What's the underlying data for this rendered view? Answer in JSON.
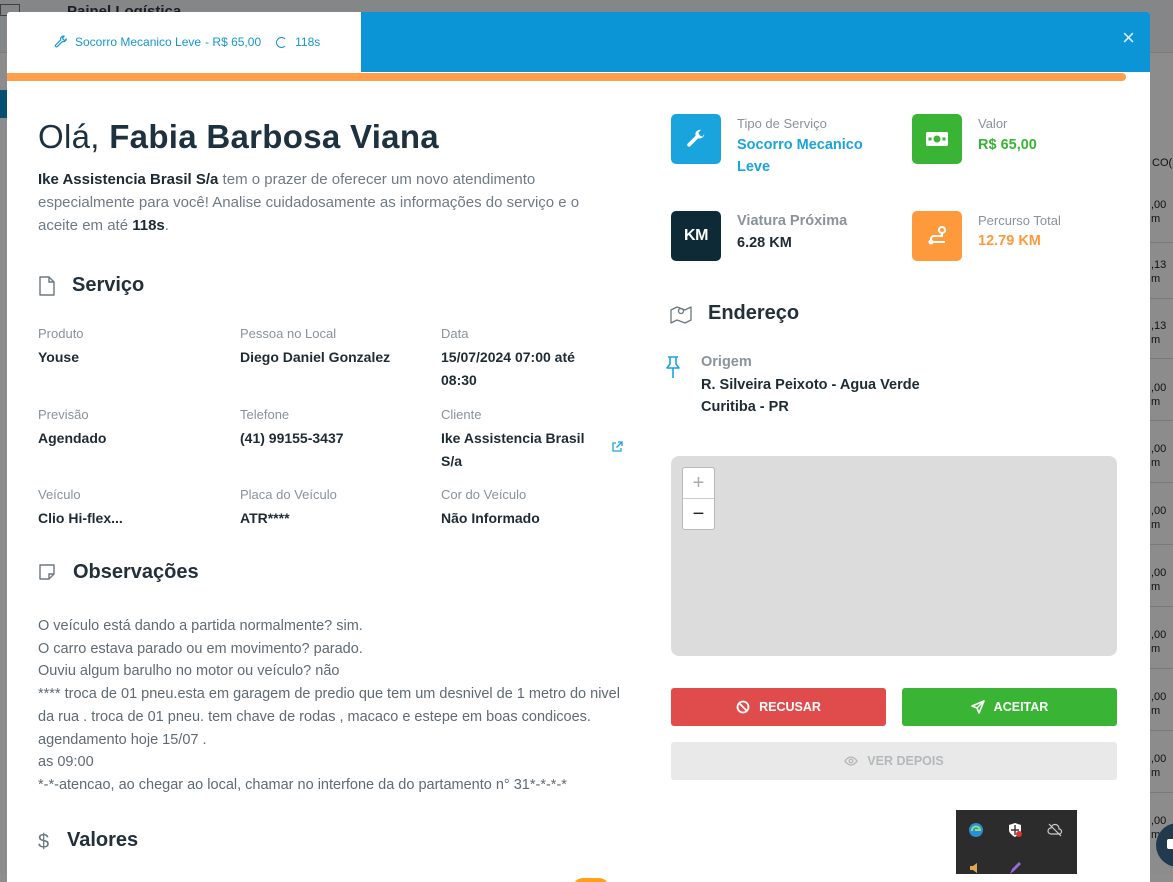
{
  "background": {
    "title": "Painel Logística",
    "column_header": "CO(S",
    "cells": [
      ",00 m",
      ",13 m",
      ",13 m",
      ",00 m",
      ",00 m",
      ",00 m",
      ",00 m",
      ",00 m",
      ",00 m",
      ",00 m",
      ",00 m"
    ]
  },
  "modal": {
    "tab": {
      "service": "Socorro Mecanico Leve",
      "price": " - R$ 65,00",
      "timer": "118s"
    },
    "close_label": "×",
    "progress": 1.0,
    "greeting": {
      "prefix": "Olá, ",
      "name": "Fabia Barbosa Viana"
    },
    "intro": {
      "company": "Ike Assistencia Brasil S/a",
      "text": " tem o prazer de oferecer um novo atendimento especialmente para você! Analise cuidadosamente as informações do serviço e o aceite em até ",
      "timer": "118s",
      "end": "."
    },
    "servico": {
      "title": "Serviço",
      "fields": {
        "produto": {
          "label": "Produto",
          "value": "Youse"
        },
        "pessoa": {
          "label": "Pessoa no Local",
          "value": "Diego Daniel Gonzalez"
        },
        "data": {
          "label": "Data",
          "value": "15/07/2024 07:00 até 08:30"
        },
        "previsao": {
          "label": "Previsão",
          "value": "Agendado"
        },
        "telefone": {
          "label": "Telefone",
          "value": "(41) 99155-3437"
        },
        "cliente": {
          "label": "Cliente",
          "value": "Ike Assistencia Brasil S/a"
        },
        "veiculo": {
          "label": "Veículo",
          "value": "Clio Hi-flex..."
        },
        "placa": {
          "label": "Placa do Veículo",
          "value": "ATR****"
        },
        "cor": {
          "label": "Cor do Veículo",
          "value": "Não Informado"
        }
      }
    },
    "observacoes": {
      "title": "Observações",
      "text": "O veículo está dando a partida normalmente? sim.\nO carro estava parado ou em movimento? parado.\nOuviu algum barulho no motor ou veículo? não\n**** troca de 01 pneu.esta em garagem de predio que tem um desnivel de 1 metro do nivel da rua . troca de 01 pneu. tem chave de rodas , macaco e estepe em boas condicoes. agendamento hoje 15/07 .\nas 09:00\n*-*-atencao, ao chegar ao local, chamar no interfone da do partamento n° 31*-*-*-*"
    },
    "valores": {
      "title": "Valores"
    },
    "cards": {
      "tipo": {
        "label": "Tipo de Serviço",
        "value": "Socorro Mecanico Leve",
        "color": "#1aa4dd"
      },
      "valor": {
        "label": "Valor",
        "value": "R$ 65,00",
        "color": "#3ab434"
      },
      "viatura": {
        "label": "Viatura Próxima",
        "value": "6.28 KM",
        "icon_text": "KM",
        "color": "#0d2a36"
      },
      "percurso": {
        "label": "Percurso Total",
        "value": "12.79 KM",
        "color": "#ff9a3c"
      }
    },
    "endereco": {
      "title": "Endereço",
      "origem_label": "Origem",
      "line1": "R. Silveira Peixoto - Agua Verde",
      "line2": "Curitiba - PR"
    },
    "map": {
      "zoom_in": "+",
      "zoom_out": "−"
    },
    "buttons": {
      "recusar": "RECUSAR",
      "aceitar": "ACEITAR",
      "ver_depois": "VER DEPOIS"
    }
  },
  "colors": {
    "header_blue": "#0c95d6",
    "progress_orange": "#ff9f4a",
    "recusar_red": "#e04b4b",
    "aceitar_green": "#3ab434"
  }
}
